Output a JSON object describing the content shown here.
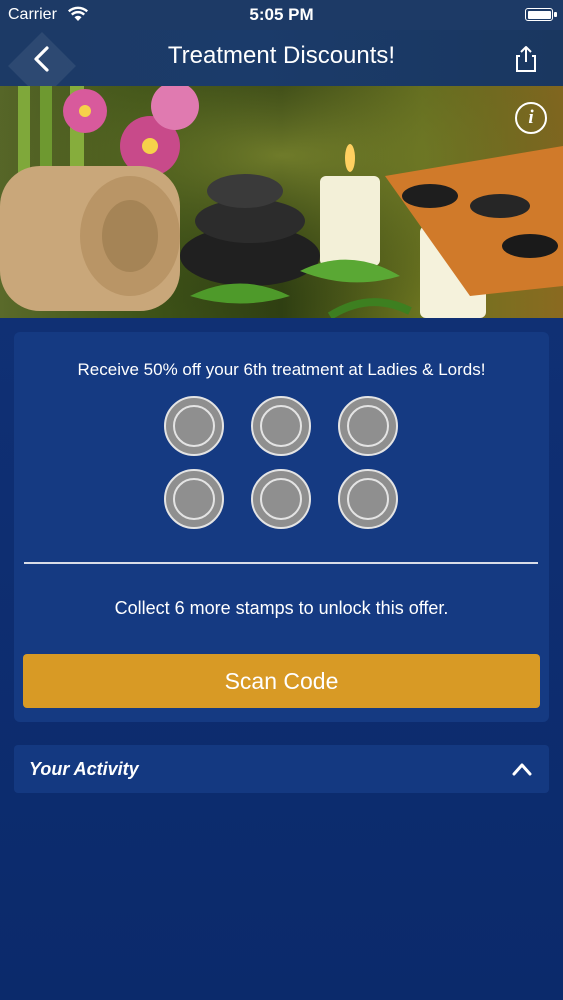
{
  "status_bar": {
    "carrier": "Carrier",
    "time": "5:05 PM"
  },
  "nav": {
    "title": "Treatment Discounts!"
  },
  "offer": {
    "description": "Receive 50% off your 6th treatment at Ladies & Lords!",
    "stamps_total": 6,
    "stamps_collected": 0,
    "collect_message": "Collect 6 more stamps to unlock this offer.",
    "scan_label": "Scan Code"
  },
  "activity": {
    "label": "Your Activity"
  },
  "colors": {
    "background": "#0f2f73",
    "card": "#153a82",
    "accent_button": "#d89a25",
    "stamp_empty": "#8f8f8f"
  }
}
